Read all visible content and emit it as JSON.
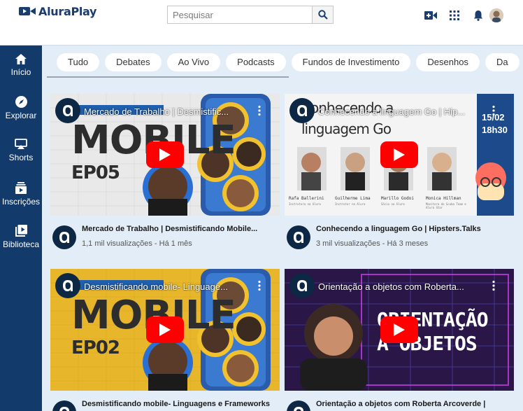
{
  "app": {
    "name": "AluraPlay"
  },
  "search": {
    "placeholder": "Pesquisar"
  },
  "header_icons": [
    "video-camera-icon",
    "apps-grid-icon",
    "bell-icon",
    "user-avatar"
  ],
  "sidebar": {
    "items": [
      {
        "label": "Início",
        "icon": "home-icon"
      },
      {
        "label": "Explorar",
        "icon": "compass-icon"
      },
      {
        "label": "Shorts",
        "icon": "cast-icon"
      },
      {
        "label": "Inscrições",
        "icon": "subscriptions-icon"
      },
      {
        "label": "Biblioteca",
        "icon": "library-icon"
      }
    ]
  },
  "chips": [
    "Tudo",
    "Debates",
    "Ao Vivo",
    "Podcasts",
    "Fundos de Investimento",
    "Desenhos",
    "Da"
  ],
  "videos": [
    {
      "overlay_title": "Mercado de Trabalho | Desmistific...",
      "title": "Mercado de Trabalho | Desmistificando Mobile...",
      "stats": "1,1 mil visualizações - Há 1 mês",
      "thumb_text_1": "MOBILE",
      "thumb_text_2": "EP05",
      "thumb_text_top": "DESMISTIFICANDO"
    },
    {
      "overlay_title": "Conhecendo a linguagem Go | Hip...",
      "title": "Conhecendo a linguagem Go | Hipsters.Talks",
      "stats": "3 mil visualizações - Há 3 meses",
      "thumb_text_1": "linguagem Go",
      "thumb_text_top": "Conhecendo a",
      "date_badge": "15/02",
      "time_badge": "18h30",
      "speakers": [
        {
          "name": "Rafa Ballerini",
          "role": "Instrutora na Alura"
        },
        {
          "name": "Guilherme Lima",
          "role": "Instrutor na Alura"
        },
        {
          "name": "Marillo Godoi",
          "role": "Sócio na Alura"
        },
        {
          "name": "Monica Hillman",
          "role": "Monitora do Scuba Team e Alura Star"
        }
      ]
    },
    {
      "overlay_title": "Desmistificando mobile- Linguage...",
      "title": "Desmistificando mobile- Linguagens e Frameworks",
      "stats": "",
      "thumb_text_1": "MOBILE",
      "thumb_text_2": "EP02",
      "thumb_text_top": "DESMISTIFICANDO"
    },
    {
      "overlay_title": "Orientação a objetos com Roberta...",
      "title": "Orientação a objetos com Roberta Arcoverde |",
      "stats": "",
      "thumb_text_1": "ORIENTAÇÃO",
      "thumb_text_2": "A OBJETOS"
    }
  ],
  "colors": {
    "sidebar_bg": "#123b6c",
    "main_bg": "#e3edf7",
    "accent_blue": "#1a3d6e",
    "play_red": "#ff0000",
    "mobile_yellow": "#f2c12e",
    "orient_bg": "#2a1748"
  }
}
